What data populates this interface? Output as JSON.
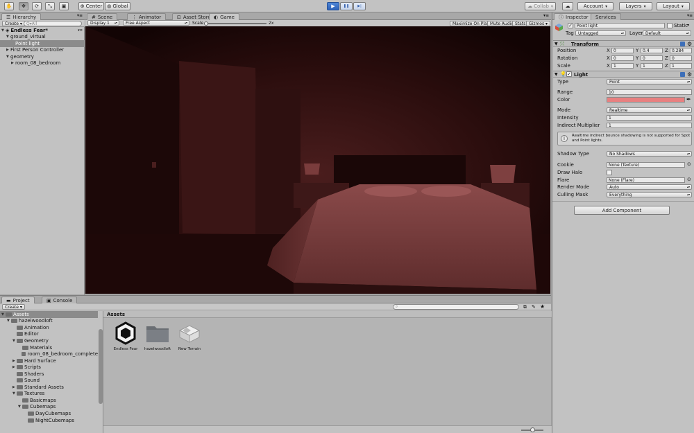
{
  "toolbar": {
    "tools": [
      "hand-tool",
      "move-tool",
      "rotate-tool",
      "scale-tool",
      "rect-tool"
    ],
    "pivot_label": "Center",
    "space_label": "Global",
    "play_label": "▶",
    "pause_label": "❚❚",
    "step_label": "▶|",
    "collab_label": "Collab",
    "account_label": "Account",
    "layers_label": "Layers",
    "layout_label": "Layout"
  },
  "hierarchy": {
    "tab": "Hierarchy",
    "create_label": "Create",
    "search_placeholder": "Q▾All",
    "rows": [
      {
        "label": "Endless Fear*",
        "indent": 0,
        "tri": "▼",
        "bold": true,
        "selected": false
      },
      {
        "label": "ground_virtual",
        "indent": 1,
        "tri": "▼",
        "selected": false
      },
      {
        "label": "Point light",
        "indent": 2,
        "tri": "",
        "selected": true
      },
      {
        "label": "First Person Controller",
        "indent": 1,
        "tri": "▶",
        "selected": false
      },
      {
        "label": "geometry",
        "indent": 1,
        "tri": "▼",
        "selected": false
      },
      {
        "label": "room_08_bedroom",
        "indent": 2,
        "tri": "▶",
        "selected": false
      }
    ]
  },
  "center_tabs": [
    {
      "label": "Scene",
      "icon": "#"
    },
    {
      "label": "Animator",
      "icon": "⋮"
    },
    {
      "label": "Asset Store",
      "icon": "⊡"
    },
    {
      "label": "Game",
      "icon": "◐",
      "active": true
    }
  ],
  "game_bar": {
    "display": "Display 1",
    "aspect": "Free Aspect",
    "scale_label": "Scale",
    "scale_value": "2x",
    "maximize": "Maximize On Play",
    "mute": "Mute Audio",
    "stats": "Stats",
    "gizmos": "Gizmos"
  },
  "project": {
    "tabs": [
      "Project",
      "Console"
    ],
    "create_label": "Create",
    "breadcrumb": "Assets",
    "tree": [
      {
        "label": "Assets",
        "indent": 0,
        "tri": "▼",
        "selected": true
      },
      {
        "label": "hazelwoodloft",
        "indent": 1,
        "tri": "▼"
      },
      {
        "label": "Animation",
        "indent": 2,
        "tri": ""
      },
      {
        "label": "Editor",
        "indent": 2,
        "tri": ""
      },
      {
        "label": "Geometry",
        "indent": 2,
        "tri": "▼"
      },
      {
        "label": "Materials",
        "indent": 3,
        "tri": ""
      },
      {
        "label": "room_08_bedroom_complete",
        "indent": 3,
        "tri": ""
      },
      {
        "label": "Hard Surface",
        "indent": 2,
        "tri": "▶"
      },
      {
        "label": "Scripts",
        "indent": 2,
        "tri": "▶"
      },
      {
        "label": "Shaders",
        "indent": 2,
        "tri": ""
      },
      {
        "label": "Sound",
        "indent": 2,
        "tri": ""
      },
      {
        "label": "Standard Assets",
        "indent": 2,
        "tri": "▶"
      },
      {
        "label": "Textures",
        "indent": 2,
        "tri": "▼"
      },
      {
        "label": "Basicmaps",
        "indent": 3,
        "tri": ""
      },
      {
        "label": "Cubemaps",
        "indent": 3,
        "tri": "▼"
      },
      {
        "label": "DayCubemaps",
        "indent": 4,
        "tri": ""
      },
      {
        "label": "NightCubemaps",
        "indent": 4,
        "tri": ""
      }
    ],
    "assets": [
      {
        "label": "Endless Fear",
        "kind": "unity-scene-icon"
      },
      {
        "label": "hazelwoodloft",
        "kind": "folder-icon"
      },
      {
        "label": "New Terrain",
        "kind": "terrain-icon"
      }
    ]
  },
  "inspector": {
    "tabs": [
      "Inspector",
      "Services"
    ],
    "object_name": "Point light",
    "static_label": "Static",
    "tag_label": "Tag",
    "tag_value": "Untagged",
    "layer_label": "Layer",
    "layer_value": "Default",
    "transform": {
      "title": "Transform",
      "rows": [
        {
          "label": "Position",
          "x": "0",
          "y": "0.4",
          "z": "0.284"
        },
        {
          "label": "Rotation",
          "x": "0",
          "y": "0",
          "z": "0"
        },
        {
          "label": "Scale",
          "x": "1",
          "y": "1",
          "z": "1"
        }
      ]
    },
    "light": {
      "title": "Light",
      "type_label": "Type",
      "type_value": "Point",
      "range_label": "Range",
      "range_value": "10",
      "color_label": "Color",
      "color_value": "#e88080",
      "mode_label": "Mode",
      "mode_value": "Realtime",
      "intensity_label": "Intensity",
      "intensity_value": "1",
      "indirect_label": "Indirect Multiplier",
      "indirect_value": "1",
      "info_text": "Realtime indirect bounce shadowing is not supported for Spot and Point lights.",
      "shadow_label": "Shadow Type",
      "shadow_value": "No Shadows",
      "cookie_label": "Cookie",
      "cookie_value": "None (Texture)",
      "halo_label": "Draw Halo",
      "flare_label": "Flare",
      "flare_value": "None (Flare)",
      "render_label": "Render Mode",
      "render_value": "Auto",
      "culling_label": "Culling Mask",
      "culling_value": "Everything"
    },
    "add_component": "Add Component"
  }
}
